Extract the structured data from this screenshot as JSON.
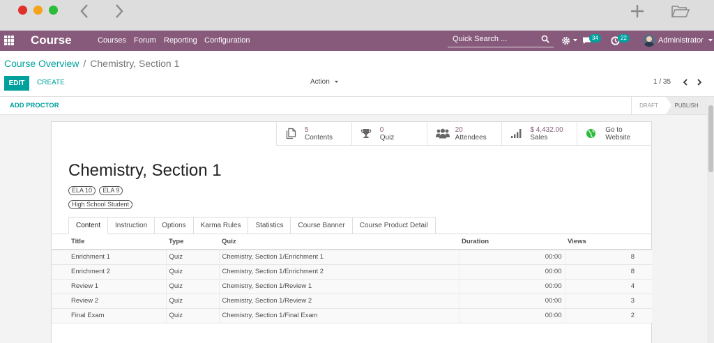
{
  "nav": {
    "brand": "Course",
    "menu": [
      "Courses",
      "Forum",
      "Reporting",
      "Configuration"
    ],
    "search_placeholder": "Quick Search ...",
    "messages_count": "34",
    "activities_count": "22",
    "user": "Administrator"
  },
  "control": {
    "breadcrumb_parent": "Course Overview",
    "breadcrumb_sep": "/",
    "breadcrumb_current": "Chemistry, Section 1",
    "edit_label": "EDIT",
    "create_label": "CREATE",
    "action_label": "Action",
    "pager": "1 / 35"
  },
  "statusbar": {
    "add_proctor": "ADD PROCTOR",
    "stages": [
      "DRAFT",
      "PUBLISH"
    ]
  },
  "smart_buttons": [
    {
      "value": "5",
      "label": "Contents",
      "icon": "documents-icon"
    },
    {
      "value": "0",
      "label": "Quiz",
      "icon": "trophy-icon"
    },
    {
      "value": "20",
      "label": "Attendees",
      "icon": "users-icon"
    },
    {
      "value": "$ 4,432.00",
      "label": "Sales",
      "icon": "bar-chart-icon"
    },
    {
      "value": "Go to",
      "label": "Website",
      "icon": "globe-icon"
    }
  ],
  "record": {
    "title": "Chemistry, Section 1",
    "tags": [
      "ELA 10",
      "ELA 9"
    ],
    "tag_audience": "High School Student"
  },
  "tabs": [
    "Content",
    "Instruction",
    "Options",
    "Karma Rules",
    "Statistics",
    "Course Banner",
    "Course Product Detail"
  ],
  "table": {
    "headers": [
      "Title",
      "Type",
      "Quiz",
      "Duration",
      "Views"
    ],
    "rows": [
      [
        "Enrichment 1",
        "Quiz",
        "Chemistry, Section 1/Enrichment 1",
        "00:00",
        "8"
      ],
      [
        "Enrichment 2",
        "Quiz",
        "Chemistry, Section 1/Enrichment 2",
        "00:00",
        "8"
      ],
      [
        "Review 1",
        "Quiz",
        "Chemistry, Section 1/Review 1",
        "00:00",
        "4"
      ],
      [
        "Review 2",
        "Quiz",
        "Chemistry, Section 1/Review 2",
        "00:00",
        "3"
      ],
      [
        "Final Exam",
        "Quiz",
        "Chemistry, Section 1/Final Exam",
        "00:00",
        "2"
      ]
    ]
  },
  "colors": {
    "brand": "#875a7b",
    "accent": "#00a09d"
  }
}
